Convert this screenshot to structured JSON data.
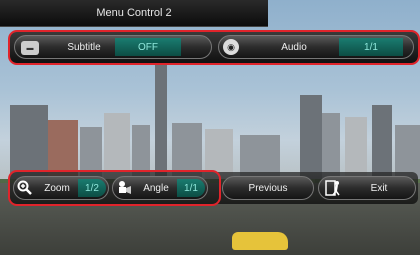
{
  "window": {
    "title": "Menu Control 2"
  },
  "top_bar": {
    "subtitle": {
      "label": "Subtitle",
      "value": "OFF",
      "icon": "subtitle-icon"
    },
    "audio": {
      "label": "Audio",
      "value": "1/1",
      "icon": "audio-icon"
    }
  },
  "bottom_bar": {
    "zoom": {
      "label": "Zoom",
      "value": "1/2",
      "icon": "zoom-icon"
    },
    "angle": {
      "label": "Angle",
      "value": "1/1",
      "icon": "angle-icon"
    },
    "previous": {
      "label": "Previous"
    },
    "exit": {
      "label": "Exit",
      "icon": "exit-icon"
    }
  },
  "colors": {
    "highlight": "#e0242b",
    "value_bg": "#0c4d44",
    "value_text": "#8fe8dc"
  }
}
